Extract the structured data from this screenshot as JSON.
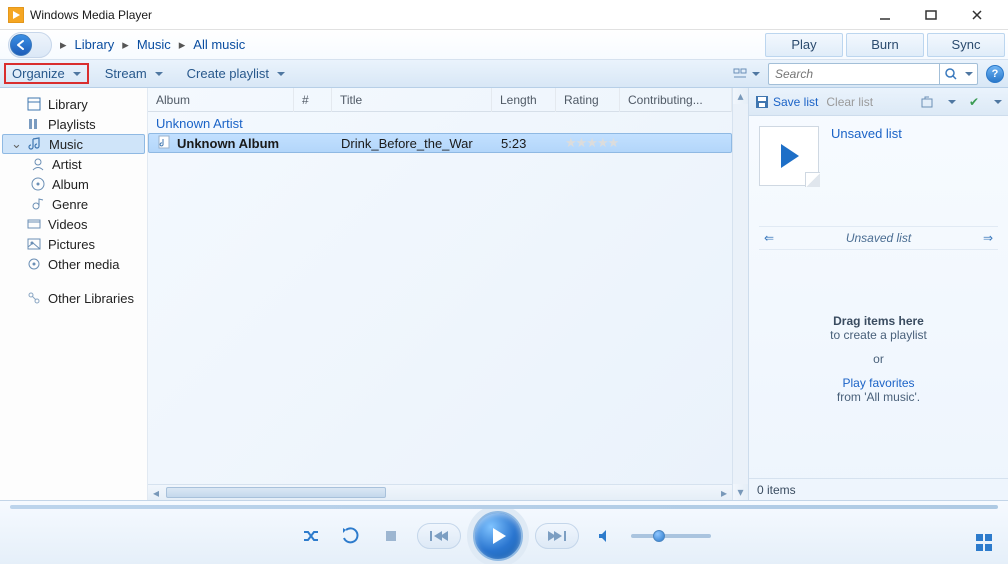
{
  "window": {
    "title": "Windows Media Player"
  },
  "tabs": {
    "play": "Play",
    "burn": "Burn",
    "sync": "Sync"
  },
  "breadcrumb": {
    "a": "Library",
    "b": "Music",
    "c": "All music"
  },
  "toolbar": {
    "organize": "Organize",
    "stream": "Stream",
    "create": "Create playlist"
  },
  "search": {
    "placeholder": "Search"
  },
  "sidebar": {
    "library": "Library",
    "playlists": "Playlists",
    "music": "Music",
    "artist": "Artist",
    "album": "Album",
    "genre": "Genre",
    "videos": "Videos",
    "pictures": "Pictures",
    "other": "Other media",
    "other_libraries": "Other Libraries"
  },
  "columns": {
    "album": "Album",
    "num": "#",
    "title": "Title",
    "length": "Length",
    "rating": "Rating",
    "contributing": "Contributing..."
  },
  "track": {
    "artist": "Unknown Artist",
    "album": "Unknown Album",
    "title": "Drink_Before_the_War",
    "length": "5:23"
  },
  "list_panel": {
    "save": "Save list",
    "clear": "Clear list",
    "unsaved": "Unsaved list",
    "unsaved2": "Unsaved list",
    "drag": "Drag items here",
    "tocreate": "to create a playlist",
    "or": "or",
    "play_fav": "Play favorites",
    "from": "from 'All music'.",
    "status": "0 items"
  }
}
